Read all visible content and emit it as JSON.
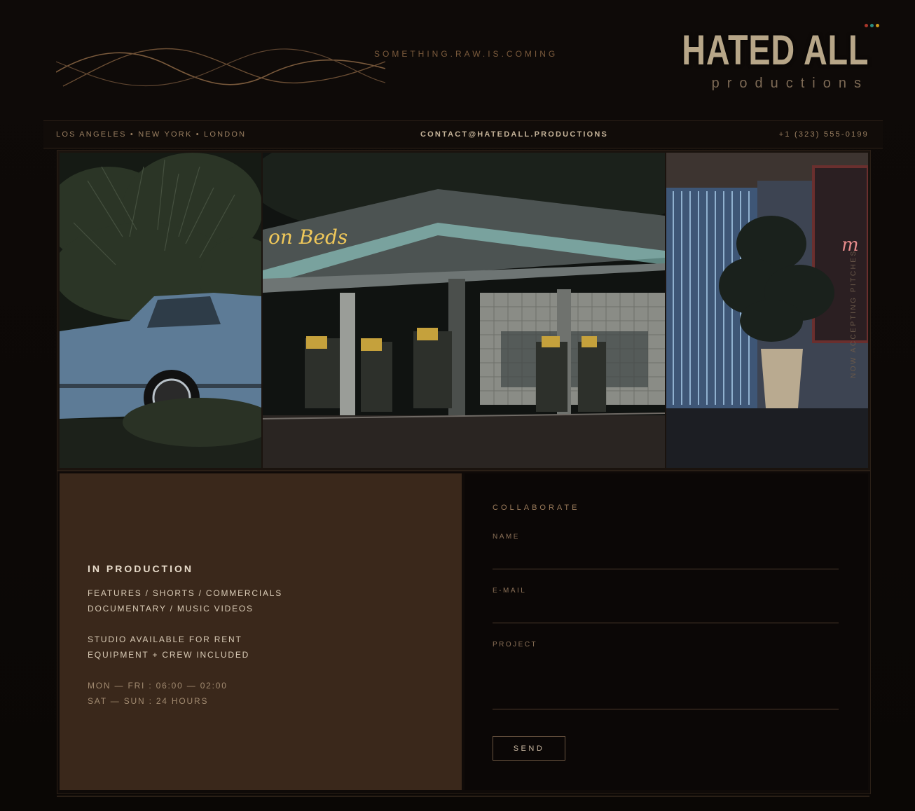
{
  "header": {
    "tagline": "SOMETHING.RAW.IS.COMING",
    "brand_title": "HATED ALL",
    "brand_sub": "productions"
  },
  "status_dots": [
    "#c0392b",
    "#2a9d8f",
    "#d4a017"
  ],
  "infobar": {
    "locations": "LOS ANGELES • NEW YORK • LONDON",
    "email": "CONTACT@HATEDALL.PRODUCTIONS",
    "phone": "+1 (323) 555-0199"
  },
  "gallery": {
    "vertical_note": "NOW ACCEPTING PITCHES",
    "neon_sign_left": "on Beds",
    "neon_sign_right": "m"
  },
  "info_card": {
    "title": "IN PRODUCTION",
    "line1": "FEATURES / SHORTS / COMMERCIALS",
    "line2": "DOCUMENTARY / MUSIC VIDEOS",
    "line3": "STUDIO AVAILABLE FOR RENT",
    "line4": "EQUIPMENT + CREW INCLUDED",
    "hours1": "MON — FRI : 06:00 — 02:00",
    "hours2": "SAT — SUN : 24 HOURS"
  },
  "form": {
    "heading": "COLLABORATE",
    "name_label": "NAME",
    "name_value": "",
    "email_label": "E-MAIL",
    "email_value": "",
    "project_label": "PROJECT",
    "project_value": "",
    "send_label": "SEND"
  },
  "colors": {
    "accent": "#9b7b5b",
    "panel": "#3a281b",
    "background": "#0d0907"
  }
}
